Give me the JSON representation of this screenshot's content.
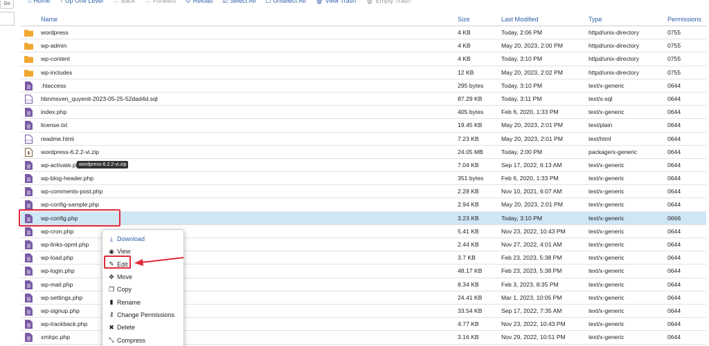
{
  "go": {
    "label": "Go"
  },
  "toolbar": [
    {
      "label": "Home",
      "icon": "home-icon",
      "glyph": "⌂",
      "disabled": false
    },
    {
      "label": "Up One Level",
      "icon": "up-level-icon",
      "glyph": "↑",
      "disabled": false
    },
    {
      "label": "Back",
      "icon": "back-arrow-icon",
      "glyph": "←",
      "disabled": true
    },
    {
      "label": "Forward",
      "icon": "forward-arrow-icon",
      "glyph": "→",
      "disabled": true
    },
    {
      "label": "Reload",
      "icon": "reload-icon",
      "glyph": "↻",
      "disabled": false
    },
    {
      "label": "Select All",
      "icon": "checkbox-checked-icon",
      "glyph": "☑",
      "disabled": false
    },
    {
      "label": "Unselect All",
      "icon": "checkbox-empty-icon",
      "glyph": "☐",
      "disabled": false
    },
    {
      "label": "View Trash",
      "icon": "trash-icon",
      "glyph": "🗑",
      "disabled": false
    },
    {
      "label": "Empty Trash",
      "icon": "trash-icon",
      "glyph": "🗑",
      "disabled": true
    }
  ],
  "columns": {
    "name": "Name",
    "size": "Size",
    "modified": "Last Modified",
    "type": "Type",
    "perms": "Permissions"
  },
  "files": [
    {
      "name": "wordpress",
      "size": "4 KB",
      "modified": "Today, 2:06 PM",
      "type": "httpd/unix-directory",
      "perms": "0755",
      "kind": "folder"
    },
    {
      "name": "wp-admin",
      "size": "4 KB",
      "modified": "May 20, 2023, 2:00 PM",
      "type": "httpd/unix-directory",
      "perms": "0755",
      "kind": "folder"
    },
    {
      "name": "wp-content",
      "size": "4 KB",
      "modified": "Today, 3:10 PM",
      "type": "httpd/unix-directory",
      "perms": "0755",
      "kind": "folder"
    },
    {
      "name": "wp-includes",
      "size": "12 KB",
      "modified": "May 20, 2023, 2:02 PM",
      "type": "httpd/unix-directory",
      "perms": "0755",
      "kind": "folder"
    },
    {
      "name": ".htaccess",
      "size": "295 bytes",
      "modified": "Today, 3:10 PM",
      "type": "text/x-generic",
      "perms": "0644",
      "kind": "text"
    },
    {
      "name": "hbnmsven_quyenit-2023-05-25-52dad4d.sql",
      "size": "87.29 KB",
      "modified": "Today, 3:11 PM",
      "type": "text/x-sql",
      "perms": "0644",
      "kind": "code"
    },
    {
      "name": "index.php",
      "size": "405 bytes",
      "modified": "Feb 6, 2020, 1:33 PM",
      "type": "text/x-generic",
      "perms": "0644",
      "kind": "text"
    },
    {
      "name": "license.txt",
      "size": "19.45 KB",
      "modified": "May 20, 2023, 2:01 PM",
      "type": "text/plain",
      "perms": "0644",
      "kind": "text"
    },
    {
      "name": "readme.html",
      "size": "7.23 KB",
      "modified": "May 20, 2023, 2:01 PM",
      "type": "text/html",
      "perms": "0644",
      "kind": "code"
    },
    {
      "name": "wordpress-6.2.2-vi.zip",
      "size": "24.05 MB",
      "modified": "Today, 2:00 PM",
      "type": "package/x-generic",
      "perms": "0644",
      "kind": "zip"
    },
    {
      "name": "wp-activate.php",
      "size": "7.04 KB",
      "modified": "Sep 17, 2022, 6:13 AM",
      "type": "text/x-generic",
      "perms": "0644",
      "kind": "text"
    },
    {
      "name": "wp-blog-header.php",
      "size": "351 bytes",
      "modified": "Feb 6, 2020, 1:33 PM",
      "type": "text/x-generic",
      "perms": "0644",
      "kind": "text"
    },
    {
      "name": "wp-comments-post.php",
      "size": "2.28 KB",
      "modified": "Nov 10, 2021, 6:07 AM",
      "type": "text/x-generic",
      "perms": "0644",
      "kind": "text"
    },
    {
      "name": "wp-config-sample.php",
      "size": "2.94 KB",
      "modified": "May 20, 2023, 2:01 PM",
      "type": "text/x-generic",
      "perms": "0644",
      "kind": "text"
    },
    {
      "name": "wp-config.php",
      "size": "3.23 KB",
      "modified": "Today, 3:10 PM",
      "type": "text/x-generic",
      "perms": "0666",
      "kind": "text",
      "selected": true
    },
    {
      "name": "wp-cron.php",
      "size": "5.41 KB",
      "modified": "Nov 23, 2022, 10:43 PM",
      "type": "text/x-generic",
      "perms": "0644",
      "kind": "text"
    },
    {
      "name": "wp-links-opml.php",
      "size": "2.44 KB",
      "modified": "Nov 27, 2022, 4:01 AM",
      "type": "text/x-generic",
      "perms": "0644",
      "kind": "text"
    },
    {
      "name": "wp-load.php",
      "size": "3.7 KB",
      "modified": "Feb 23, 2023, 5:38 PM",
      "type": "text/x-generic",
      "perms": "0644",
      "kind": "text"
    },
    {
      "name": "wp-login.php",
      "size": "48.17 KB",
      "modified": "Feb 23, 2023, 5:38 PM",
      "type": "text/x-generic",
      "perms": "0644",
      "kind": "text"
    },
    {
      "name": "wp-mail.php",
      "size": "8.34 KB",
      "modified": "Feb 3, 2023, 8:35 PM",
      "type": "text/x-generic",
      "perms": "0644",
      "kind": "text"
    },
    {
      "name": "wp-settings.php",
      "size": "24.41 KB",
      "modified": "Mar 1, 2023, 10:05 PM",
      "type": "text/x-generic",
      "perms": "0644",
      "kind": "text"
    },
    {
      "name": "wp-signup.php",
      "size": "33.54 KB",
      "modified": "Sep 17, 2022, 7:35 AM",
      "type": "text/x-generic",
      "perms": "0644",
      "kind": "text"
    },
    {
      "name": "wp-trackback.php",
      "size": "4.77 KB",
      "modified": "Nov 23, 2022, 10:43 PM",
      "type": "text/x-generic",
      "perms": "0644",
      "kind": "text"
    },
    {
      "name": "xmlrpc.php",
      "size": "3.16 KB",
      "modified": "Nov 29, 2022, 10:51 PM",
      "type": "text/x-generic",
      "perms": "0644",
      "kind": "text"
    }
  ],
  "tooltip": "wordpress-6.2.2-vi.zip",
  "context_menu": [
    {
      "label": "Download",
      "icon": "download-icon",
      "glyph": "⤓",
      "primary": true
    },
    {
      "label": "View",
      "icon": "eye-icon",
      "glyph": "◉",
      "primary": false
    },
    {
      "label": "Edit",
      "icon": "pencil-icon",
      "glyph": "✎",
      "primary": false
    },
    {
      "label": "Move",
      "icon": "move-icon",
      "glyph": "✥",
      "primary": false
    },
    {
      "label": "Copy",
      "icon": "copy-icon",
      "glyph": "❐",
      "primary": false
    },
    {
      "label": "Rename",
      "icon": "rename-file-icon",
      "glyph": "▮",
      "primary": false
    },
    {
      "label": "Change Permissions",
      "icon": "key-icon",
      "glyph": "⚷",
      "primary": false
    },
    {
      "label": "Delete",
      "icon": "delete-x-icon",
      "glyph": "✖",
      "primary": false
    },
    {
      "label": "Compress",
      "icon": "compress-icon",
      "glyph": "⤡",
      "primary": false
    }
  ],
  "colors": {
    "link": "#2d5ea8",
    "selected_row": "#cfe6f5",
    "highlight": "#e0283a",
    "folder": "#f0a830",
    "file": "#7a5aa6"
  }
}
